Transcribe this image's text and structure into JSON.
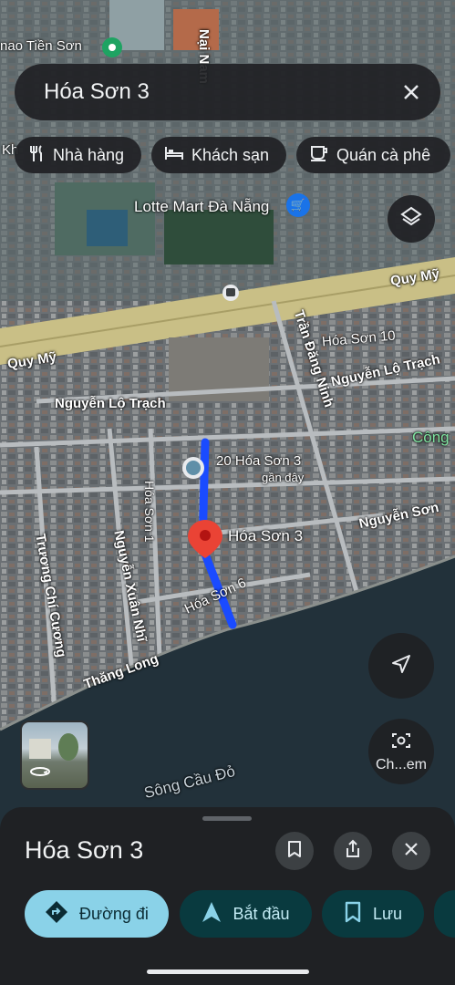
{
  "search": {
    "query": "Hóa Sơn 3",
    "clear_icon": "close-icon"
  },
  "chips": [
    {
      "label": "Nhà hàng",
      "icon": "restaurant-icon"
    },
    {
      "label": "Khách sạn",
      "icon": "hotel-icon"
    },
    {
      "label": "Quán cà phê",
      "icon": "coffee-icon"
    }
  ],
  "map_labels": {
    "poi_top": "nao Tiền Sơn",
    "kh": "Kh",
    "nai_nam": "Nại Nam",
    "lotte": "Lotte Mart Đà Nẵng",
    "quy_my_right": "Quy Mỹ",
    "quy_my_left": "Quy Mỹ",
    "tran_dang_ninh": "Trần Đăng Ninh",
    "hoa_son_10": "Hóa Sơn 10",
    "nguyen_lo_trach_right": "Nguyễn Lộ Trạch",
    "nguyen_lo_trach_left": "Nguyễn Lộ Trạch",
    "cong": "Công",
    "address_20": "20 Hóa Sơn 3",
    "gan_day": "gần đây",
    "hoa_son_1": "Hóa Sơn 1",
    "hoa_son_3": "Hóa Sơn 3",
    "nguyen_son": "Nguyễn Sơn",
    "truong_chi_cuong": "Trương Chí Cương",
    "nguyen_xuan_nhi": "Nguyễn Xuân Nhĩ",
    "hoa_son_6": "Hóa Sơn 6",
    "thang_long": "Thăng Long",
    "song_cau_do": "Sông Cầu Đỏ"
  },
  "controls": {
    "layers_icon": "layers-icon",
    "navigate_icon": "navigation-arrow-icon",
    "camera_label": "Ch...em",
    "camera_icon": "camera-icon",
    "streetview_icon": "street-view-360-icon"
  },
  "sheet": {
    "title": "Hóa Sơn 3",
    "bookmark_icon": "bookmark-icon",
    "share_icon": "share-icon",
    "close_icon": "close-icon",
    "directions_label": "Đường đi",
    "start_label": "Bắt đầu",
    "save_label": "Lưu"
  },
  "colors": {
    "accent": "#8ad2e8",
    "route": "#1a4bff",
    "pin": "#ea4335",
    "dark_button": "#093a3f"
  }
}
